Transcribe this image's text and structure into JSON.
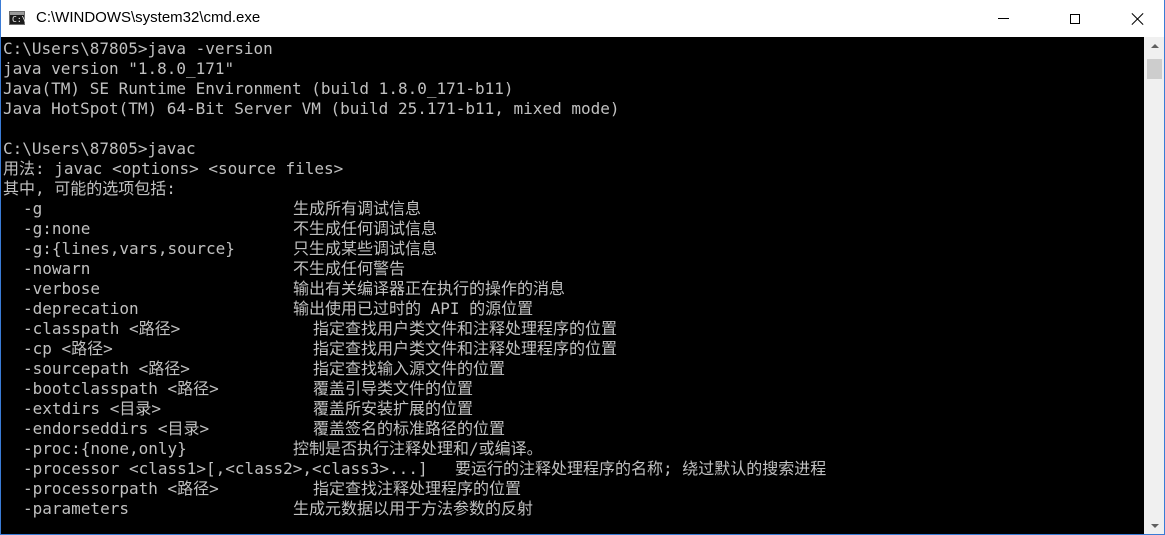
{
  "window": {
    "title": "C:\\WINDOWS\\system32\\cmd.exe",
    "icon": "cmd-icon",
    "controls": [
      "minimize-icon",
      "maximize-icon",
      "close-icon"
    ]
  },
  "console": {
    "colors": {
      "background": "#000000",
      "text": "#c0c0c0"
    },
    "lines": [
      "C:\\Users\\87805>java -version",
      "java version \"1.8.0_171\"",
      "Java(TM) SE Runtime Environment (build 1.8.0_171-b11)",
      "Java HotSpot(TM) 64-Bit Server VM (build 25.171-b11, mixed mode)",
      "",
      "C:\\Users\\87805>javac",
      "用法: javac <options> <source files>",
      "其中, 可能的选项包括:"
    ],
    "options": [
      {
        "flag": "-g",
        "desc": "生成所有调试信息",
        "indent": 0
      },
      {
        "flag": "-g:none",
        "desc": "不生成任何调试信息",
        "indent": 0
      },
      {
        "flag": "-g:{lines,vars,source}",
        "desc": "只生成某些调试信息",
        "indent": 0
      },
      {
        "flag": "-nowarn",
        "desc": "不生成任何警告",
        "indent": 0
      },
      {
        "flag": "-verbose",
        "desc": "输出有关编译器正在执行的操作的消息",
        "indent": 0
      },
      {
        "flag": "-deprecation",
        "desc": "输出使用已过时的 API 的源位置",
        "indent": 0
      },
      {
        "flag": "-classpath <路径>",
        "desc": "指定查找用户类文件和注释处理程序的位置",
        "indent": 1
      },
      {
        "flag": "-cp <路径>",
        "desc": "指定查找用户类文件和注释处理程序的位置",
        "indent": 1
      },
      {
        "flag": "-sourcepath <路径>",
        "desc": "指定查找输入源文件的位置",
        "indent": 1
      },
      {
        "flag": "-bootclasspath <路径>",
        "desc": "覆盖引导类文件的位置",
        "indent": 1
      },
      {
        "flag": "-extdirs <目录>",
        "desc": "覆盖所安装扩展的位置",
        "indent": 1
      },
      {
        "flag": "-endorseddirs <目录>",
        "desc": "覆盖签名的标准路径的位置",
        "indent": 1
      },
      {
        "flag": "-proc:{none,only}",
        "desc": "控制是否执行注释处理和/或编译。",
        "indent": 0
      },
      {
        "flag": "-processor <class1>[,<class2>,<class3>...]",
        "desc": "要运行的注释处理程序的名称; 绕过默认的搜索进程",
        "indent": 2
      },
      {
        "flag": "-processorpath <路径>",
        "desc": "指定查找注释处理程序的位置",
        "indent": 1
      },
      {
        "flag": "-parameters",
        "desc": "生成元数据以用于方法参数的反射",
        "indent": 0
      }
    ]
  }
}
